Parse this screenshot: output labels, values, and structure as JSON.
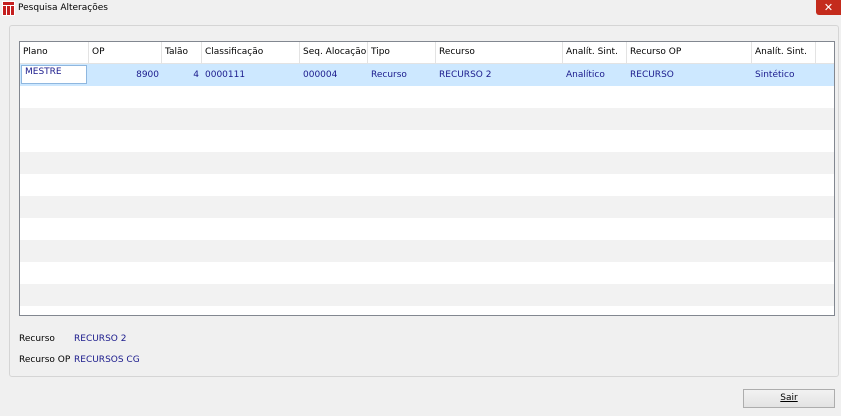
{
  "window": {
    "title": "Pesquisa Alterações",
    "close_label": "✕"
  },
  "grid": {
    "columns": [
      "Plano",
      "OP",
      "Talão",
      "Classificação",
      "Seq. Alocação",
      "Tipo",
      "Recurso",
      "Analít. Sint.",
      "Recurso OP",
      "Analít. Sint."
    ],
    "rows": [
      [
        "MESTRE",
        "8900",
        "4",
        "0000111",
        "000004",
        "Recurso",
        "RECURSO 2",
        "Analítico",
        "RECURSO",
        "Sintético"
      ]
    ]
  },
  "info": {
    "recurso_label": "Recurso",
    "recurso_value": "RECURSO 2",
    "recurso_op_label": "Recurso OP",
    "recurso_op_value": "RECURSOS CG"
  },
  "buttons": {
    "sair": "Sair"
  }
}
